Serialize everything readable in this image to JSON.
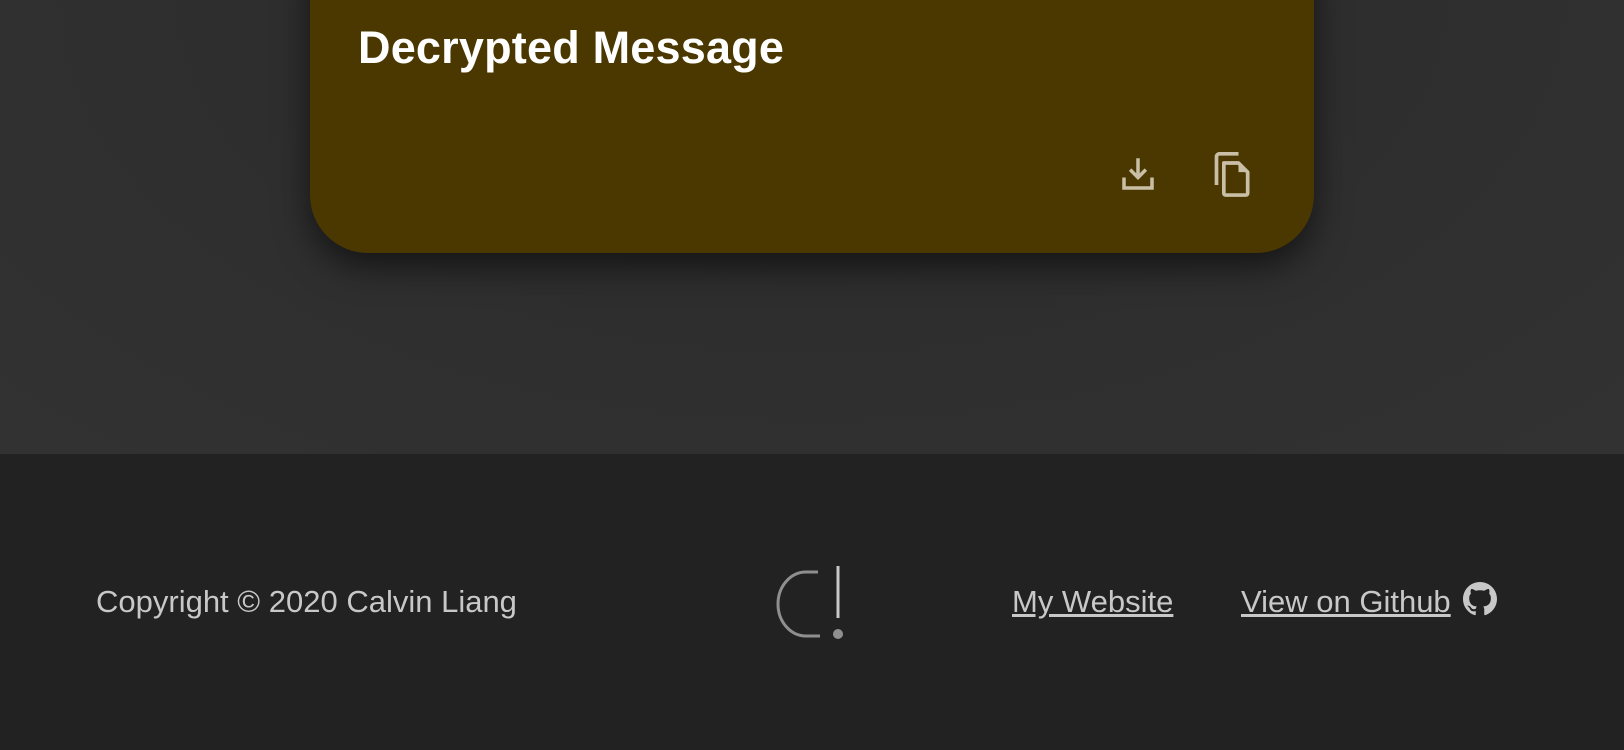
{
  "card": {
    "title": "Decrypted Message",
    "background_color": "#4a3800",
    "actions": [
      {
        "icon": "download-icon"
      },
      {
        "icon": "copy-icon"
      }
    ]
  },
  "footer": {
    "copyright": "Copyright © 2020 Calvin Liang",
    "logo_icon": "logo-icon",
    "links": {
      "website": "My Website",
      "github": "View on Github"
    },
    "github_icon": "github-icon"
  },
  "colors": {
    "page_background": "#2f2f2f",
    "footer_background": "#222222",
    "text_muted": "#c8c8c8"
  }
}
